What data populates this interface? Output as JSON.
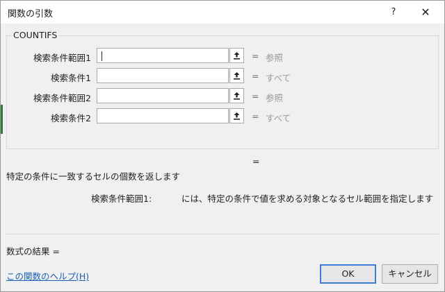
{
  "window": {
    "title": "関数の引数",
    "help_label": "?",
    "close_label": "✕"
  },
  "function_name": "COUNTIFS",
  "arguments": [
    {
      "label": "検索条件範囲1",
      "value": "",
      "equals": "=",
      "hint": "参照"
    },
    {
      "label": "検索条件1",
      "value": "",
      "equals": "=",
      "hint": "すべて"
    },
    {
      "label": "検索条件範囲2",
      "value": "",
      "equals": "=",
      "hint": "参照"
    },
    {
      "label": "検索条件2",
      "value": "",
      "equals": "=",
      "hint": "すべて"
    }
  ],
  "result_equals": "=",
  "description": "特定の条件に一致するセルの個数を返します",
  "argument_help": {
    "name": "検索条件範囲1:",
    "text": "には、特定の条件で値を求める対象となるセル範囲を指定します"
  },
  "formula_result_label": "数式の結果 =",
  "help_link": "この関数のヘルプ(H)",
  "buttons": {
    "ok": "OK",
    "cancel": "キャンセル"
  },
  "icons": {
    "collapse": "collapse-dialog-arrow-icon"
  }
}
